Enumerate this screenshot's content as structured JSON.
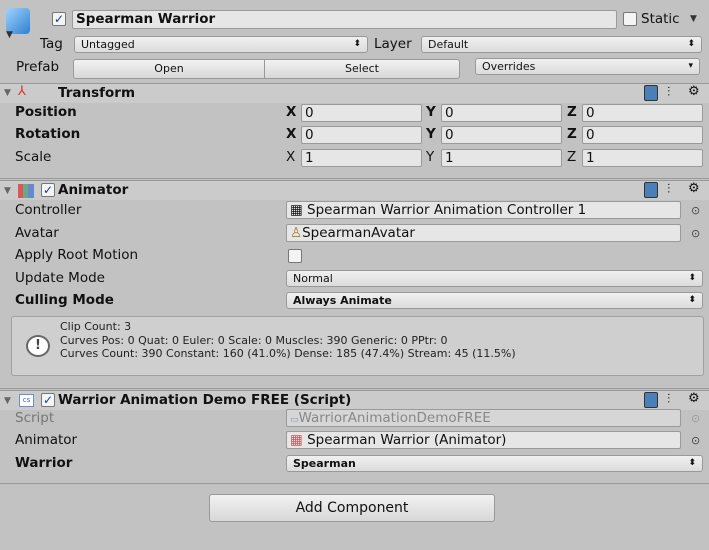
{
  "gameobject": {
    "name": "Spearman Warrior",
    "active": true,
    "static_label": "Static",
    "static": false,
    "tag_label": "Tag",
    "tag": "Untagged",
    "layer_label": "Layer",
    "layer": "Default",
    "prefab_label": "Prefab",
    "open_label": "Open",
    "select_label": "Select",
    "overrides_label": "Overrides"
  },
  "transform": {
    "title": "Transform",
    "rows": [
      {
        "label": "Position",
        "x": "0",
        "y": "0",
        "z": "0"
      },
      {
        "label": "Rotation",
        "x": "0",
        "y": "0",
        "z": "0"
      },
      {
        "label": "Scale",
        "x": "1",
        "y": "1",
        "z": "1"
      }
    ],
    "axis": {
      "x": "X",
      "y": "Y",
      "z": "Z"
    }
  },
  "animator": {
    "title": "Animator",
    "enabled": true,
    "controller_label": "Controller",
    "controller": "Spearman Warrior Animation Controller 1",
    "avatar_label": "Avatar",
    "avatar": "SpearmanAvatar",
    "root_motion_label": "Apply Root Motion",
    "root_motion": false,
    "update_mode_label": "Update Mode",
    "update_mode": "Normal",
    "culling_mode_label": "Culling Mode",
    "culling_mode": "Always Animate",
    "info": [
      "Clip Count: 3",
      "Curves Pos: 0 Quat: 0 Euler: 0 Scale: 0 Muscles: 390 Generic: 0 PPtr: 0",
      "Curves Count: 390 Constant: 160 (41.0%) Dense: 185 (47.4%) Stream: 45 (11.5%)"
    ]
  },
  "script": {
    "title": "Warrior Animation Demo FREE (Script)",
    "enabled": true,
    "script_label": "Script",
    "script": "WarriorAnimationDemoFREE",
    "animator_label": "Animator",
    "animator": "Spearman Warrior (Animator)",
    "warrior_label": "Warrior",
    "warrior": "Spearman"
  },
  "add_component_label": "Add Component"
}
